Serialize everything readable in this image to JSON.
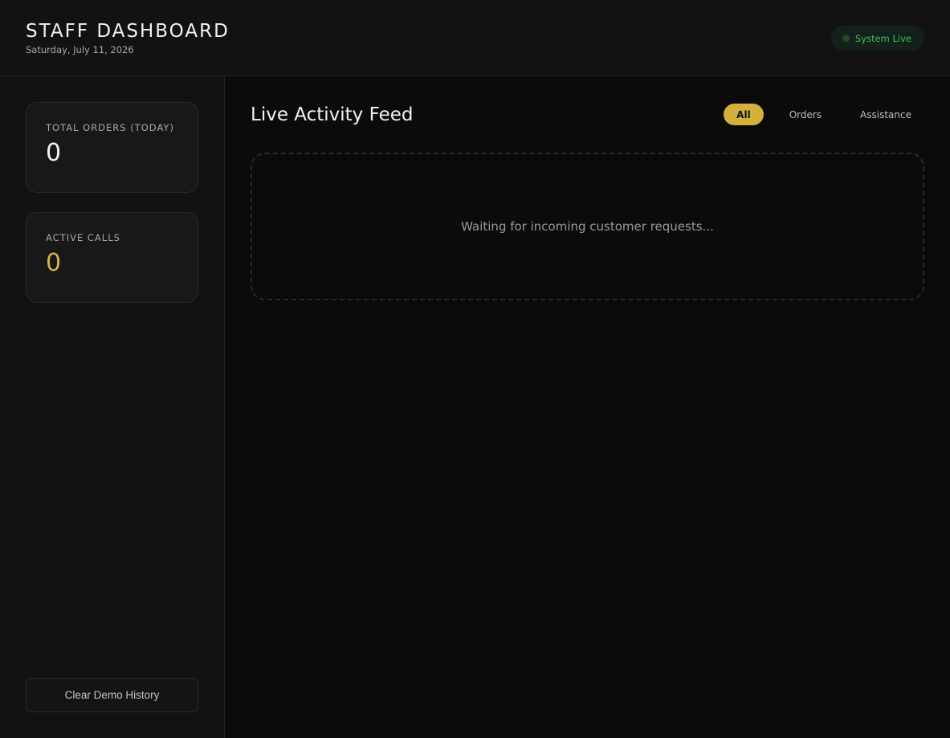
{
  "header": {
    "title": "STAFF DASHBOARD",
    "date": "Saturday, July 11, 2026",
    "status_label": "System Live"
  },
  "sidebar": {
    "stats": [
      {
        "label": "TOTAL ORDERS (TODAY)",
        "value": "0"
      },
      {
        "label": "ACTIVE CALLS",
        "value": "0"
      }
    ],
    "clear_button_label": "Clear Demo History"
  },
  "main": {
    "feed_title": "Live Activity Feed",
    "filters": [
      {
        "label": "All",
        "active": true
      },
      {
        "label": "Orders",
        "active": false
      },
      {
        "label": "Assistance",
        "active": false
      }
    ],
    "empty_message": "Waiting for incoming customer requests..."
  },
  "colors": {
    "accent_gold": "#d4b03c",
    "status_green": "#3fbf5f",
    "background": "#0b0b0b",
    "panel": "#121212"
  }
}
